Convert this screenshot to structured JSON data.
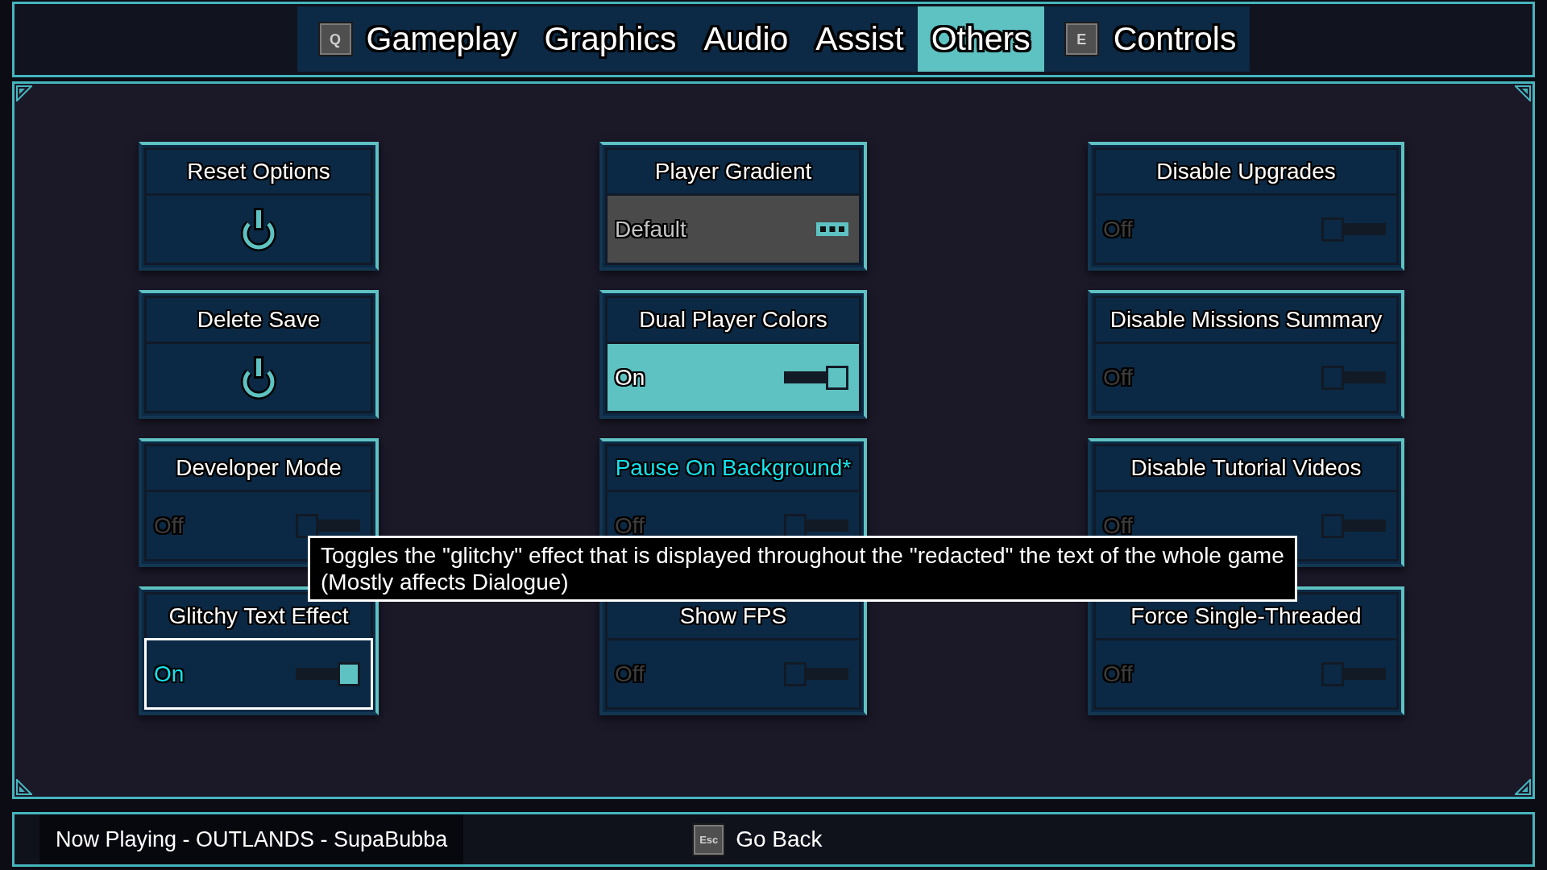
{
  "tab_bar": {
    "prev_key": "Q",
    "tabs": [
      {
        "label": "Gameplay",
        "selected": false
      },
      {
        "label": "Graphics",
        "selected": false
      },
      {
        "label": "Audio",
        "selected": false
      },
      {
        "label": "Assist",
        "selected": false
      },
      {
        "label": "Others",
        "selected": true
      }
    ],
    "next_key": "E",
    "next_tabs": [
      {
        "label": "Controls",
        "selected": false
      }
    ]
  },
  "options": [
    {
      "kind": "button",
      "title": "Reset Options",
      "selected": false,
      "hovered": false,
      "disabled": false,
      "highlighted": false
    },
    {
      "kind": "selector",
      "title": "Player Gradient",
      "value": "Default",
      "selected": false,
      "hovered": false,
      "disabled": true,
      "highlighted": false
    },
    {
      "kind": "toggle",
      "title": "Disable Upgrades",
      "value": "Off",
      "on": false,
      "selected": false,
      "hovered": false,
      "disabled": false,
      "highlighted": false
    },
    {
      "kind": "button",
      "title": "Delete Save",
      "selected": false,
      "hovered": false,
      "disabled": false,
      "highlighted": false
    },
    {
      "kind": "toggle",
      "title": "Dual Player Colors",
      "value": "On",
      "on": true,
      "selected": false,
      "hovered": true,
      "disabled": false,
      "highlighted": false
    },
    {
      "kind": "toggle",
      "title": "Disable Missions Summary",
      "value": "Off",
      "on": false,
      "selected": false,
      "hovered": false,
      "disabled": false,
      "highlighted": false
    },
    {
      "kind": "toggle",
      "title": "Developer Mode",
      "value": "Off",
      "on": false,
      "selected": false,
      "hovered": false,
      "disabled": false,
      "highlighted": false
    },
    {
      "kind": "toggle",
      "title": "Pause On Background*",
      "value": "Off",
      "on": false,
      "selected": false,
      "hovered": false,
      "disabled": false,
      "highlighted": true
    },
    {
      "kind": "toggle",
      "title": "Disable Tutorial Videos",
      "value": "Off",
      "on": false,
      "selected": false,
      "hovered": false,
      "disabled": false,
      "highlighted": false
    },
    {
      "kind": "toggle",
      "title": "Glitchy Text Effect",
      "value": "On",
      "on": true,
      "selected": true,
      "hovered": false,
      "disabled": false,
      "highlighted": false
    },
    {
      "kind": "toggle",
      "title": "Show FPS",
      "value": "Off",
      "on": false,
      "selected": false,
      "hovered": false,
      "disabled": false,
      "highlighted": false
    },
    {
      "kind": "toggle",
      "title": "Force Single-Threaded",
      "value": "Off",
      "on": false,
      "selected": false,
      "hovered": false,
      "disabled": false,
      "highlighted": false
    }
  ],
  "tooltip": {
    "text": "Toggles the \"glitchy\" effect that is displayed throughout the \"redacted\" the text of the whole game\n(Mostly affects Dialogue)"
  },
  "status_bar": {
    "now_playing": "Now Playing - OUTLANDS - SupaBubba",
    "back_key": "Esc",
    "back_label": "Go Back"
  }
}
